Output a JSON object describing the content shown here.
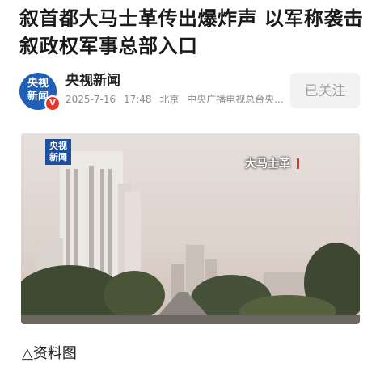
{
  "article": {
    "headline": "叙首都大马士革传出爆炸声 以军称袭击叙政权军事总部入口"
  },
  "author": {
    "avatar_text": "央视新闻",
    "verified_mark": "V",
    "name": "央视新闻",
    "date": "2025-7-16",
    "time": "17:48",
    "location": "北京",
    "source": "中央广播电视总台央...",
    "follow_label": "已关注"
  },
  "image": {
    "logo_text": "央视新闻",
    "place_label": "大马士革"
  },
  "caption": "△资料图",
  "colors": {
    "brand_blue": "#1f5fb5",
    "verified_red": "#e8352b",
    "follow_bg": "#f2f2f2"
  }
}
